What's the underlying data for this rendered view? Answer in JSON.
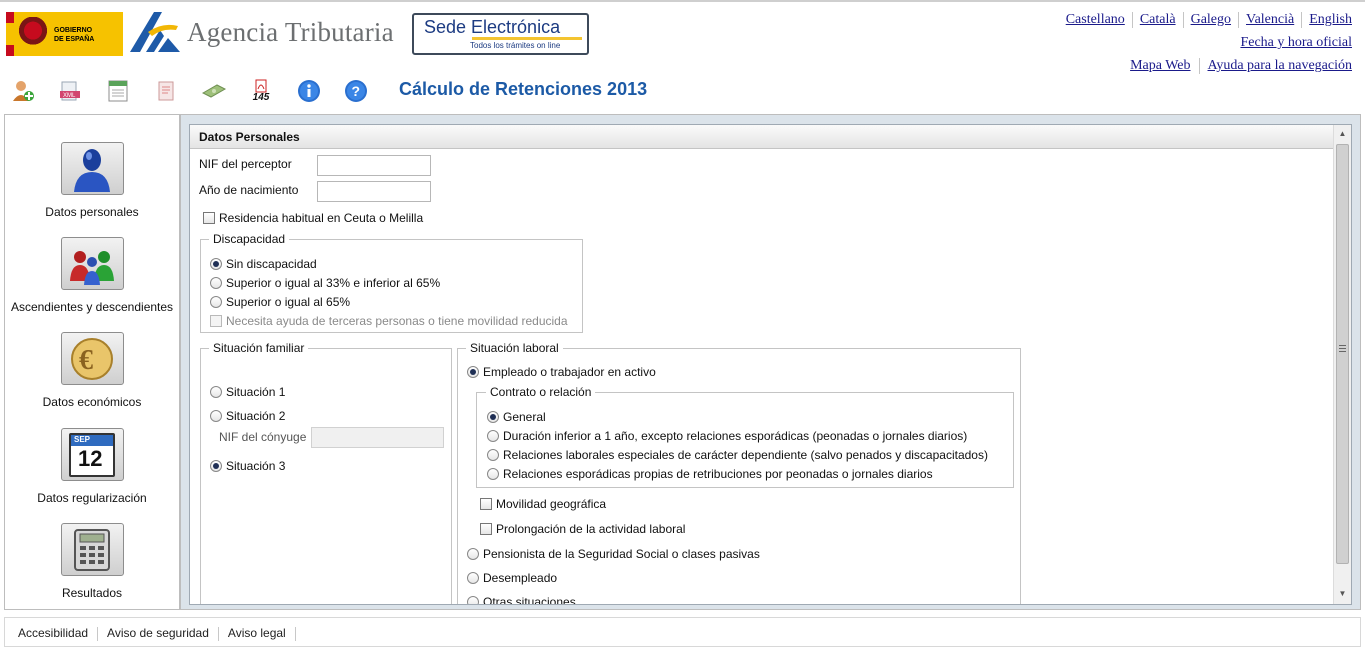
{
  "header": {
    "gov_logo_text": "GOBIERNO DE ESPAÑA",
    "brand_name": "Agencia Tributaria",
    "sede_title": "Sede Electrónica",
    "sede_subtitle": "Todos los trámites on line",
    "languages": [
      "Castellano",
      "Català",
      "Galego",
      "Valencià",
      "English"
    ],
    "datetime_link": "Fecha y hora oficial",
    "sitemap_link": "Mapa Web",
    "help_link": "Ayuda para la navegación"
  },
  "toolbar": {
    "title": "Cálculo de Retenciones 2013",
    "icons": [
      "new-perceptor-icon",
      "export-xml-icon",
      "spreadsheet-icon",
      "pdf-icon",
      "money-icon",
      "modelo-145-icon",
      "info-icon",
      "help-icon"
    ],
    "modelo_label": "145"
  },
  "sidebar": {
    "items": [
      {
        "label": "Datos personales",
        "icon": "person-icon"
      },
      {
        "label": "Ascendientes y descendientes",
        "icon": "family-icon"
      },
      {
        "label": "Datos económicos",
        "icon": "euro-icon"
      },
      {
        "label": "Datos regularización",
        "icon": "calendar-icon"
      },
      {
        "label": "Resultados",
        "icon": "calculator-icon"
      }
    ],
    "calendar_month": "SEP",
    "calendar_day": "12"
  },
  "form": {
    "panel_title": "Datos Personales",
    "nif_label": "NIF del perceptor",
    "nif_value": "",
    "birth_label": "Año de nacimiento",
    "birth_value": "",
    "residence_label": "Residencia habitual en Ceuta o Melilla",
    "disability": {
      "legend": "Discapacidad",
      "opt_none": "Sin discapacidad",
      "opt_33": "Superior o igual al 33% e inferior al 65%",
      "opt_65": "Superior o igual al 65%",
      "help_label": "Necesita ayuda de terceras personas o tiene movilidad reducida"
    },
    "family": {
      "legend": "Situación familiar",
      "opt1": "Situación 1",
      "opt2": "Situación 2",
      "spouse_nif_label": "NIF del cónyuge",
      "opt3": "Situación 3"
    },
    "labor": {
      "legend": "Situación laboral",
      "employed": "Empleado o trabajador en activo",
      "contract_legend": "Contrato o relación",
      "c_general": "General",
      "c_short": "Duración inferior a 1 año, excepto relaciones esporádicas (peonadas o jornales diarios)",
      "c_special": "Relaciones laborales especiales de carácter dependiente (salvo penados y discapacitados)",
      "c_sporadic": "Relaciones esporádicas propias de retribuciones por peonadas o jornales diarios",
      "mobility": "Movilidad geográfica",
      "prolongation": "Prolongación de la actividad laboral",
      "pensioner": "Pensionista de la Seguridad Social o clases pasivas",
      "unemployed": "Desempleado",
      "other": "Otras situaciones"
    }
  },
  "footer": {
    "links": [
      "Accesibilidad",
      "Aviso de seguridad",
      "Aviso legal"
    ]
  }
}
